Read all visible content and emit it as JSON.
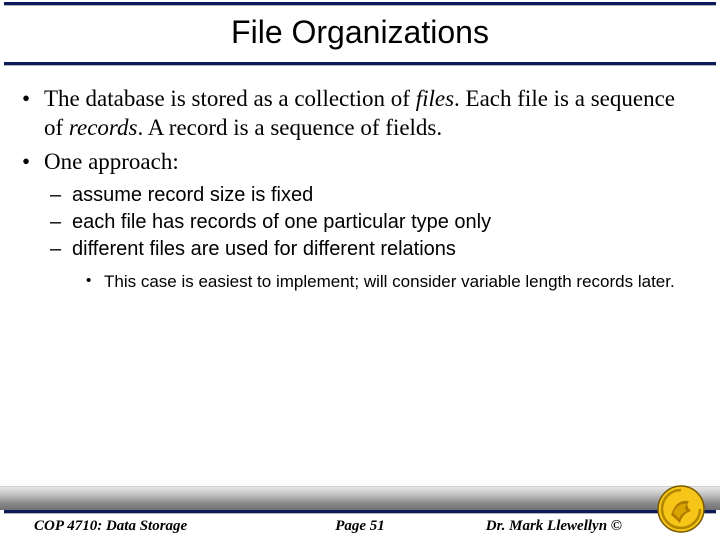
{
  "title": "File Organizations",
  "bullets": {
    "b1_pre": "The database is stored as a collection of ",
    "b1_em1": "files",
    "b1_mid1": ".  Each file is a sequence of ",
    "b1_em2": "records",
    "b1_mid2": ".  A record is a sequence of fields.",
    "b2": "One approach:",
    "s1": "assume record size is fixed",
    "s2": "each file has records of one particular type only",
    "s3": "different files are used for different relations",
    "t1": "This case is easiest to implement; will consider variable length records later."
  },
  "footer": {
    "left": "COP 4710: Data Storage",
    "center": "Page 51",
    "right": "Dr. Mark Llewellyn ©"
  }
}
